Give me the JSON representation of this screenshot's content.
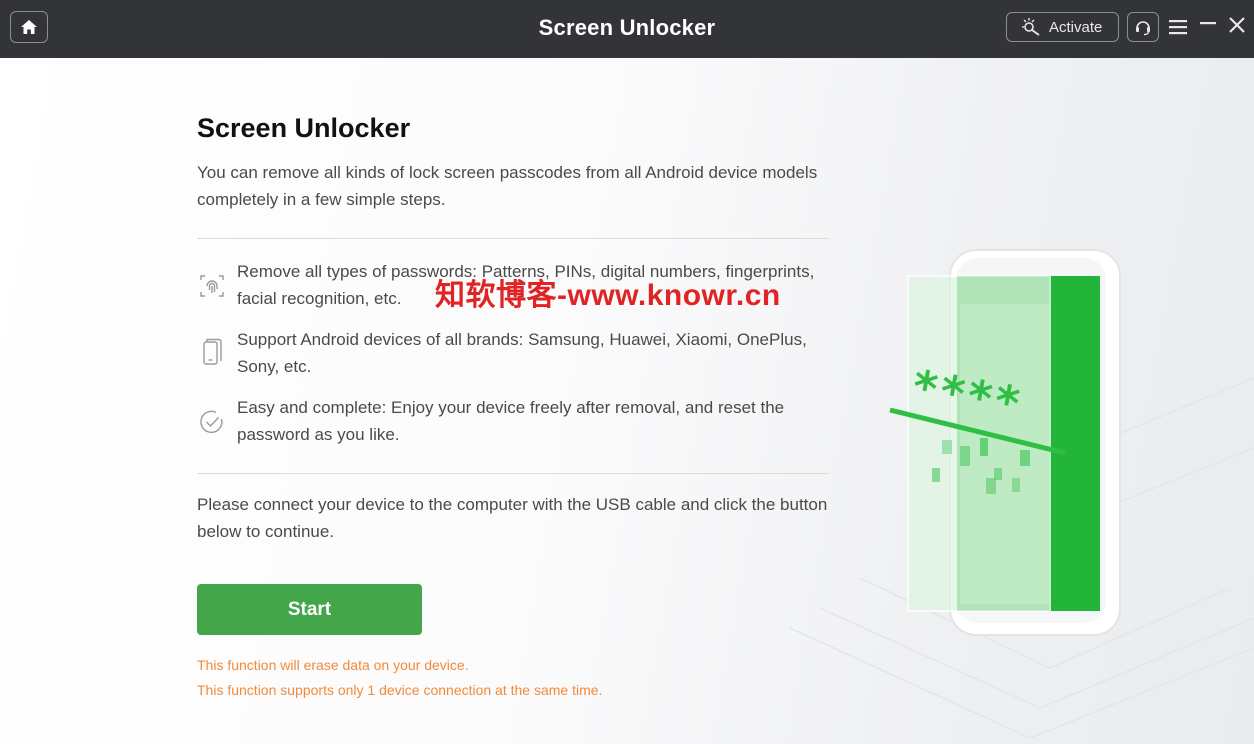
{
  "titlebar": {
    "title": "Screen Unlocker",
    "activate_label": "Activate"
  },
  "main": {
    "heading": "Screen Unlocker",
    "subtitle": "You can remove all kinds of lock screen passcodes from all Android device models completely in a few simple steps.",
    "features": [
      {
        "icon": "fingerprint-icon",
        "text": "Remove all types of passwords: Patterns, PINs, digital numbers, fingerprints, facial recognition, etc."
      },
      {
        "icon": "phones-icon",
        "text": "Support Android devices of all brands: Samsung, Huawei, Xiaomi, OnePlus, Sony, etc."
      },
      {
        "icon": "checkmark-circle-icon",
        "text": "Easy and complete: Enjoy your device freely after removal, and reset the password as you like."
      }
    ],
    "instruction": "Please connect your device to the computer with the USB cable and click the button below to continue.",
    "start_label": "Start",
    "warnings": [
      "This function will erase data on your device.",
      "This function supports only 1 device connection at the same time."
    ]
  },
  "illustration": {
    "password_mask": "****"
  },
  "watermark": "知软博客-www.knowr.cn",
  "colors": {
    "titlebar_bg": "#333437",
    "accent_green": "#43a64b",
    "warning_orange": "#f28a3b",
    "phone_green": "#23b43a"
  }
}
